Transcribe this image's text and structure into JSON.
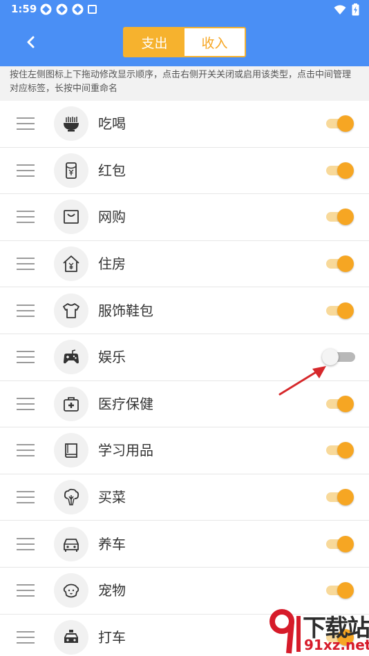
{
  "status_bar": {
    "time": "1:59"
  },
  "header": {
    "tabs": [
      {
        "label": "支出",
        "active": true
      },
      {
        "label": "收入",
        "active": false
      }
    ]
  },
  "hint": "按住左侧图标上下拖动修改显示顺序，点击右侧开关关闭或启用该类型，点击中间管理对应标签，长按中间重命名",
  "categories": [
    {
      "label": "吃喝",
      "icon": "bowl-icon",
      "enabled": true
    },
    {
      "label": "红包",
      "icon": "red-envelope-icon",
      "enabled": true
    },
    {
      "label": "网购",
      "icon": "shopping-bag-icon",
      "enabled": true
    },
    {
      "label": "住房",
      "icon": "house-icon",
      "enabled": true
    },
    {
      "label": "服饰鞋包",
      "icon": "tshirt-icon",
      "enabled": true
    },
    {
      "label": "娱乐",
      "icon": "gamepad-icon",
      "enabled": false
    },
    {
      "label": "医疗保健",
      "icon": "medical-kit-icon",
      "enabled": true
    },
    {
      "label": "学习用品",
      "icon": "book-icon",
      "enabled": true
    },
    {
      "label": "买菜",
      "icon": "vegetable-icon",
      "enabled": true
    },
    {
      "label": "养车",
      "icon": "car-icon",
      "enabled": true
    },
    {
      "label": "宠物",
      "icon": "pet-dog-icon",
      "enabled": true
    },
    {
      "label": "打车",
      "icon": "taxi-icon",
      "enabled": true
    }
  ],
  "colors": {
    "header": "#4a8ff5",
    "accent": "#f6a623"
  },
  "watermark": {
    "line1": "下载站",
    "line2": "91xz.net"
  }
}
